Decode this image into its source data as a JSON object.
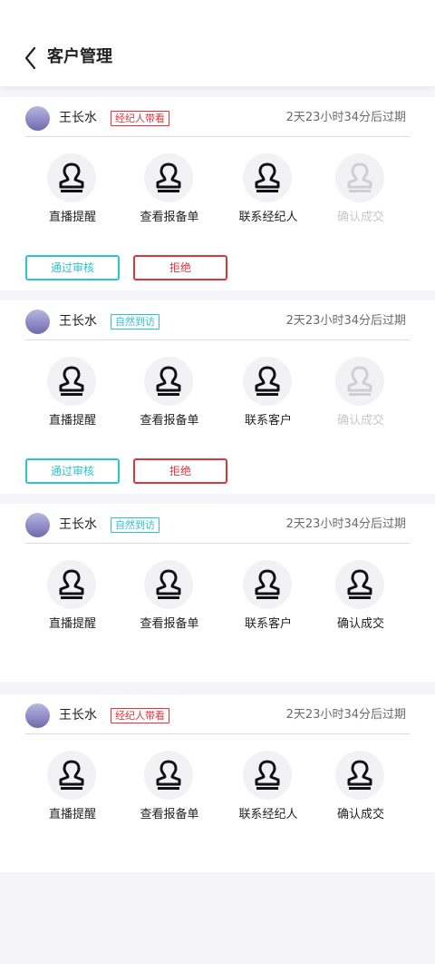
{
  "header": {
    "title": "客户管理"
  },
  "cards": [
    {
      "name": "王长水",
      "tag": "经纪人带看",
      "tag_color": "#e0343b",
      "expire": "2天23小时34分后过期",
      "actions": [
        "直播提醒",
        "查看报备单",
        "联系经纪人",
        "确认成交"
      ],
      "last_disabled": true,
      "buttons": {
        "approve": "通过审核",
        "reject": "拒绝"
      }
    },
    {
      "name": "王长水",
      "tag": "自然到访",
      "tag_color": "#2ec2cf",
      "expire": "2天23小时34分后过期",
      "actions": [
        "直播提醒",
        "查看报备单",
        "联系客户",
        "确认成交"
      ],
      "last_disabled": true,
      "buttons": {
        "approve": "通过审核",
        "reject": "拒绝"
      }
    },
    {
      "name": "王长水",
      "tag": "自然到访",
      "tag_color": "#2ec2cf",
      "expire": "2天23小时34分后过期",
      "actions": [
        "直播提醒",
        "查看报备单",
        "联系客户",
        "确认成交"
      ],
      "last_disabled": false
    },
    {
      "name": "王长水",
      "tag": "经纪人带看",
      "tag_color": "#e0343b",
      "expire": "2天23小时34分后过期",
      "actions": [
        "直播提醒",
        "查看报备单",
        "联系经纪人",
        "确认成交"
      ],
      "last_disabled": false
    }
  ],
  "icons": {
    "back": "chevron-left-icon",
    "action": "stamp-icon"
  }
}
